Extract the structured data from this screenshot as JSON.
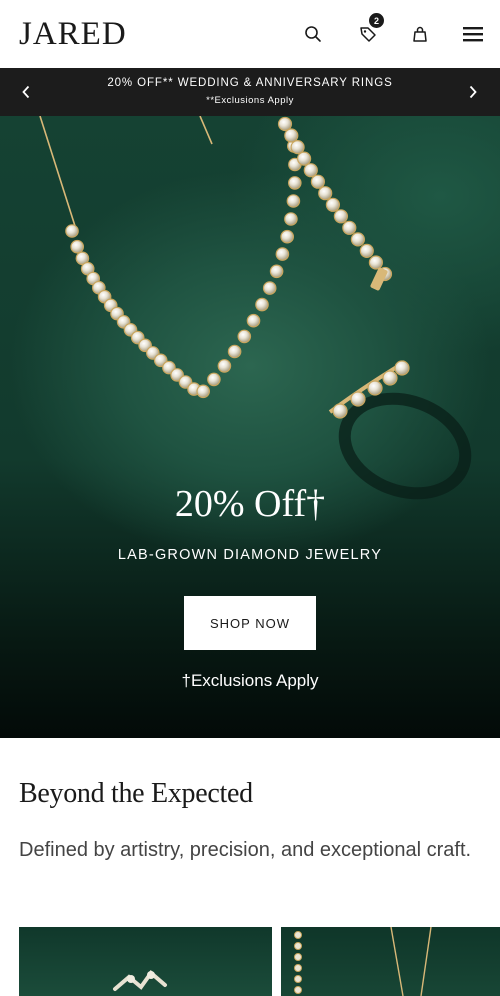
{
  "header": {
    "logo": "JARED",
    "wishlist_count": "2"
  },
  "promo": {
    "line1": "20% OFF** WEDDING & ANNIVERSARY RINGS",
    "line2": "**Exclusions Apply"
  },
  "hero": {
    "title": "20% Off†",
    "subtitle": "LAB-GROWN DIAMOND JEWELRY",
    "cta": "SHOP NOW",
    "note": "†Exclusions Apply"
  },
  "section": {
    "title": "Beyond the Expected",
    "description": "Defined by artistry, precision, and exceptional craft."
  },
  "colors": {
    "hero_green": "#1f5341",
    "promo_bg": "#1c1c1c",
    "gold": "#d8b878"
  },
  "icons": [
    "search-icon",
    "tag-icon",
    "bag-icon",
    "menu-icon",
    "chevron-left-icon",
    "chevron-right-icon"
  ]
}
